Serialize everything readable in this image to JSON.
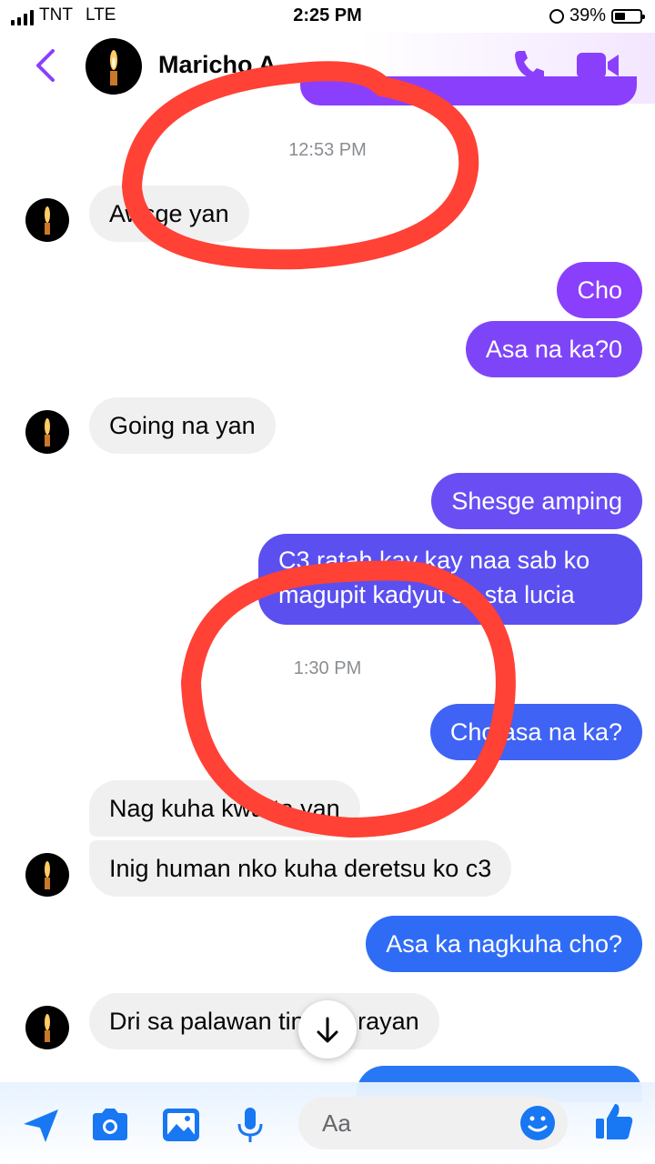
{
  "status_bar": {
    "carrier": "TNT",
    "network": "LTE",
    "time": "2:25 PM",
    "battery": "39%"
  },
  "header": {
    "contact_name": "Maricho A"
  },
  "timestamps": {
    "t1": "12:53 PM",
    "t2": "1:30 PM"
  },
  "messages": [
    {
      "side": "in",
      "text": "Awsge yan"
    },
    {
      "side": "out",
      "text": "Cho"
    },
    {
      "side": "out",
      "text": "Asa na ka?0"
    },
    {
      "side": "in",
      "text": "Going na yan"
    },
    {
      "side": "out",
      "text": "Shesge amping"
    },
    {
      "side": "out",
      "line1": "C3 ratah kay kay naa sab ko",
      "line2": "magupit kadyut sa sta lucia"
    },
    {
      "side": "out",
      "text": "Cho asa na ka?"
    },
    {
      "side": "in",
      "text": "Nag kuha kwarta yan"
    },
    {
      "side": "in",
      "text": "Inig human nko kuha deretsu ko c3"
    },
    {
      "side": "out",
      "text": "Asa ka nagkuha cho?"
    },
    {
      "side": "in",
      "text": "Dri sa palawan tingala rayan"
    }
  ],
  "composer": {
    "placeholder": "Aa"
  },
  "colors": {
    "purple": "#8a3ffc",
    "indigo": "#5b4ff0",
    "blue": "#2f6cf6",
    "annotation_red": "#ff4136"
  },
  "icons": [
    "back-icon",
    "phone-icon",
    "video-icon",
    "send-icon",
    "camera-icon",
    "gallery-icon",
    "microphone-icon",
    "emoji-icon",
    "like-icon",
    "arrow-down-icon"
  ]
}
